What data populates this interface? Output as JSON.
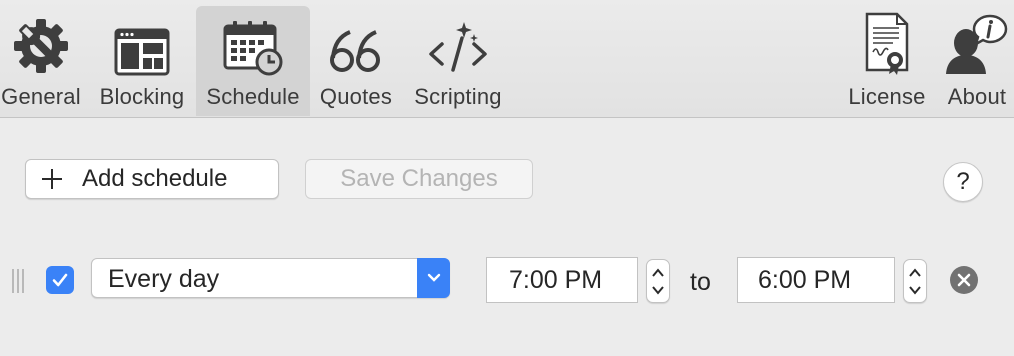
{
  "toolbar": {
    "tabs": [
      {
        "label": "General",
        "icon": "gear-wrench-icon"
      },
      {
        "label": "Blocking",
        "icon": "window-grid-icon"
      },
      {
        "label": "Schedule",
        "icon": "calendar-clock-icon",
        "selected": true
      },
      {
        "label": "Quotes",
        "icon": "quote-marks-icon"
      },
      {
        "label": "Scripting",
        "icon": "code-sparkle-icon"
      },
      {
        "label": "License",
        "icon": "certificate-icon"
      },
      {
        "label": "About",
        "icon": "person-info-icon"
      }
    ]
  },
  "actions": {
    "add_schedule_label": "Add schedule",
    "save_changes_label": "Save Changes",
    "help_label": "?"
  },
  "schedule_row": {
    "enabled": true,
    "recurrence": "Every day",
    "start_time": "7:00 PM",
    "separator": "to",
    "end_time": "6:00 PM"
  },
  "colors": {
    "accent": "#3a82f7",
    "toolbar_bg": "#e6e6e6",
    "window_bg": "#ececec",
    "selected_tab_bg": "#d3d3d3",
    "disabled_text": "#b4b4b4"
  }
}
